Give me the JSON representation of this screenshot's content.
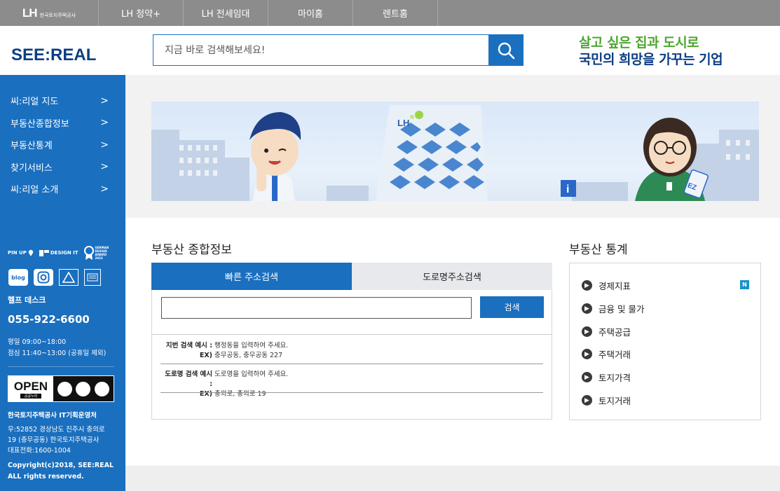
{
  "top_nav": {
    "logo_text": "LH",
    "logo_sub": "한국토지주택공사",
    "items": [
      "LH 청약+",
      "LH 전세임대",
      "마이홈",
      "렌트홈"
    ]
  },
  "header": {
    "brand": "SEE:REAL",
    "search_placeholder": "지금 바로 검색해보세요!",
    "slogan_line1": "살고 싶은 집과 도시로",
    "slogan_line2": "국민의 희망을 가꾸는 기업"
  },
  "sidebar": {
    "menu": [
      "씨:리얼 지도",
      "부동산종합정보",
      "부동산통계",
      "찾기서비스",
      "씨:리얼 소개"
    ],
    "chevron": ">",
    "awards": [
      "PIN UP",
      "DESIGN IT",
      "GERMAN DESIGN AWARD 2023"
    ],
    "blog_label": "blog",
    "help_title": "헬프 데스크",
    "help_phone": "055-922-6600",
    "hours_weekday": "평일 09:00~18:00",
    "hours_lunch": "점심 11:40~13:00 (공휴일 제외)",
    "open_label": "OPEN",
    "open_sub": "공공누리",
    "org": "한국토지주택공사 IT기획운영처",
    "address_line1": "우:52852 경상남도 진주시 충의로",
    "address_line2": "19 (충무공동) 한국토지주택공사",
    "address_line3": "대표전화:1600-1004",
    "copyright_line1": "Copyright(c)2018, SEE:REAL",
    "copyright_line2": "ALL rights reserved."
  },
  "banner": {
    "building_logo": "LH",
    "info_sign": "i",
    "card_text": "EZ"
  },
  "address_search": {
    "title": "부동산 종합정보",
    "tabs": [
      "빠른 주소검색",
      "도로명주소검색"
    ],
    "active_tab": 0,
    "input_value": "",
    "button_label": "검색",
    "examples": [
      {
        "label": "지번 검색 예시 :",
        "desc": "행정동을 입력하여 주세요.",
        "ex_label": "EX)",
        "ex": "충무공동, 충무공동 227"
      },
      {
        "label": "도로명 검색 예시 :",
        "desc": "도로명을 입력하여 주세요.",
        "ex_label": "EX)",
        "ex": "충의로, 충의로 19"
      }
    ]
  },
  "stats": {
    "title": "부동산 통계",
    "items": [
      "경제지표",
      "금융 및 물가",
      "주택공급",
      "주택거래",
      "토지가격",
      "토지거래"
    ],
    "new_badge": "N",
    "colors": {
      "primary": "#1a6fbf",
      "brand_navy": "#0d3e84",
      "slogan_green": "#4aa82c"
    }
  }
}
